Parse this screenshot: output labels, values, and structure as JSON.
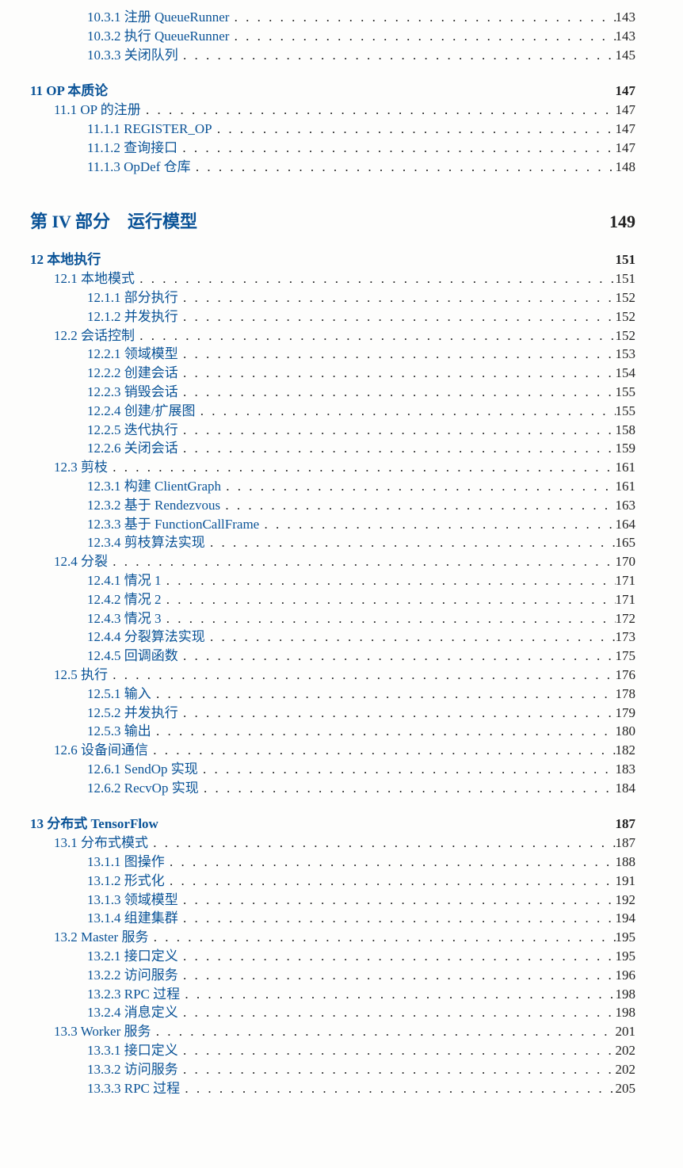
{
  "entries": [
    {
      "level": "subsection",
      "label": "10.3.1 注册 QueueRunner",
      "page": "143",
      "leader": true,
      "link": true
    },
    {
      "level": "subsection",
      "label": "10.3.2 执行 QueueRunner",
      "page": "143",
      "leader": true,
      "link": true
    },
    {
      "level": "subsection",
      "label": "10.3.3 关闭队列",
      "page": "145",
      "leader": true,
      "link": true
    },
    {
      "level": "chapter",
      "label": "11 OP 本质论",
      "page": "147",
      "leader": false,
      "link": true
    },
    {
      "level": "section",
      "label": "11.1 OP 的注册",
      "page": "147",
      "leader": true,
      "link": true
    },
    {
      "level": "subsection",
      "label": "11.1.1 REGISTER_OP",
      "page": "147",
      "leader": true,
      "link": true
    },
    {
      "level": "subsection",
      "label": "11.1.2 查询接口",
      "page": "147",
      "leader": true,
      "link": true
    },
    {
      "level": "subsection",
      "label": "11.1.3 OpDef 仓库",
      "page": "148",
      "leader": true,
      "link": true
    },
    {
      "level": "part",
      "label": "第 IV 部分　运行模型",
      "page": "149",
      "leader": false,
      "link": true
    },
    {
      "level": "chapter",
      "label": "12 本地执行",
      "page": "151",
      "leader": false,
      "link": true
    },
    {
      "level": "section",
      "label": "12.1 本地模式",
      "page": "151",
      "leader": true,
      "link": true
    },
    {
      "level": "subsection",
      "label": "12.1.1 部分执行",
      "page": "152",
      "leader": true,
      "link": true
    },
    {
      "level": "subsection",
      "label": "12.1.2 并发执行",
      "page": "152",
      "leader": true,
      "link": true
    },
    {
      "level": "section",
      "label": "12.2 会话控制",
      "page": "152",
      "leader": true,
      "link": true
    },
    {
      "level": "subsection",
      "label": "12.2.1 领域模型",
      "page": "153",
      "leader": true,
      "link": true
    },
    {
      "level": "subsection",
      "label": "12.2.2 创建会话",
      "page": "154",
      "leader": true,
      "link": true
    },
    {
      "level": "subsection",
      "label": "12.2.3 销毁会话",
      "page": "155",
      "leader": true,
      "link": true
    },
    {
      "level": "subsection",
      "label": "12.2.4 创建/扩展图",
      "page": "155",
      "leader": true,
      "link": true
    },
    {
      "level": "subsection",
      "label": "12.2.5 迭代执行",
      "page": "158",
      "leader": true,
      "link": true
    },
    {
      "level": "subsection",
      "label": "12.2.6 关闭会话",
      "page": "159",
      "leader": true,
      "link": true
    },
    {
      "level": "section",
      "label": "12.3 剪枝",
      "page": "161",
      "leader": true,
      "link": true
    },
    {
      "level": "subsection",
      "label": "12.3.1 构建 ClientGraph",
      "page": "161",
      "leader": true,
      "link": true
    },
    {
      "level": "subsection",
      "label": "12.3.2 基于 Rendezvous",
      "page": "163",
      "leader": true,
      "link": true
    },
    {
      "level": "subsection",
      "label": "12.3.3 基于 FunctionCallFrame",
      "page": "164",
      "leader": true,
      "link": true
    },
    {
      "level": "subsection",
      "label": "12.3.4 剪枝算法实现",
      "page": "165",
      "leader": true,
      "link": true
    },
    {
      "level": "section",
      "label": "12.4 分裂",
      "page": "170",
      "leader": true,
      "link": true
    },
    {
      "level": "subsection",
      "label": "12.4.1 情况 1",
      "page": "171",
      "leader": true,
      "link": true
    },
    {
      "level": "subsection",
      "label": "12.4.2 情况 2",
      "page": "171",
      "leader": true,
      "link": true
    },
    {
      "level": "subsection",
      "label": "12.4.3 情况 3",
      "page": "172",
      "leader": true,
      "link": true
    },
    {
      "level": "subsection",
      "label": "12.4.4 分裂算法实现",
      "page": "173",
      "leader": true,
      "link": true
    },
    {
      "level": "subsection",
      "label": "12.4.5 回调函数",
      "page": "175",
      "leader": true,
      "link": true
    },
    {
      "level": "section",
      "label": "12.5 执行",
      "page": "176",
      "leader": true,
      "link": true
    },
    {
      "level": "subsection",
      "label": "12.5.1 输入",
      "page": "178",
      "leader": true,
      "link": true
    },
    {
      "level": "subsection",
      "label": "12.5.2 并发执行",
      "page": "179",
      "leader": true,
      "link": true
    },
    {
      "level": "subsection",
      "label": "12.5.3 输出",
      "page": "180",
      "leader": true,
      "link": true
    },
    {
      "level": "section",
      "label": "12.6 设备间通信",
      "page": "182",
      "leader": true,
      "link": true
    },
    {
      "level": "subsection",
      "label": "12.6.1 SendOp 实现",
      "page": "183",
      "leader": true,
      "link": true
    },
    {
      "level": "subsection",
      "label": "12.6.2 RecvOp 实现",
      "page": "184",
      "leader": true,
      "link": true
    },
    {
      "level": "chapter",
      "label": "13 分布式 TensorFlow",
      "page": "187",
      "leader": false,
      "link": true
    },
    {
      "level": "section",
      "label": "13.1 分布式模式",
      "page": "187",
      "leader": true,
      "link": true
    },
    {
      "level": "subsection",
      "label": "13.1.1 图操作",
      "page": "188",
      "leader": true,
      "link": true
    },
    {
      "level": "subsection",
      "label": "13.1.2 形式化",
      "page": "191",
      "leader": true,
      "link": true
    },
    {
      "level": "subsection",
      "label": "13.1.3 领域模型",
      "page": "192",
      "leader": true,
      "link": true
    },
    {
      "level": "subsection",
      "label": "13.1.4 组建集群",
      "page": "194",
      "leader": true,
      "link": true
    },
    {
      "level": "section",
      "label": "13.2 Master 服务",
      "page": "195",
      "leader": true,
      "link": true
    },
    {
      "level": "subsection",
      "label": "13.2.1 接口定义",
      "page": "195",
      "leader": true,
      "link": true
    },
    {
      "level": "subsection",
      "label": "13.2.2 访问服务",
      "page": "196",
      "leader": true,
      "link": true
    },
    {
      "level": "subsection",
      "label": "13.2.3 RPC 过程",
      "page": "198",
      "leader": true,
      "link": true
    },
    {
      "level": "subsection",
      "label": "13.2.4 消息定义",
      "page": "198",
      "leader": true,
      "link": true
    },
    {
      "level": "section",
      "label": "13.3 Worker 服务",
      "page": "201",
      "leader": true,
      "link": true
    },
    {
      "level": "subsection",
      "label": "13.3.1 接口定义",
      "page": "202",
      "leader": true,
      "link": true
    },
    {
      "level": "subsection",
      "label": "13.3.2 访问服务",
      "page": "202",
      "leader": true,
      "link": true
    },
    {
      "level": "subsection",
      "label": "13.3.3 RPC 过程",
      "page": "205",
      "leader": true,
      "link": true
    }
  ]
}
